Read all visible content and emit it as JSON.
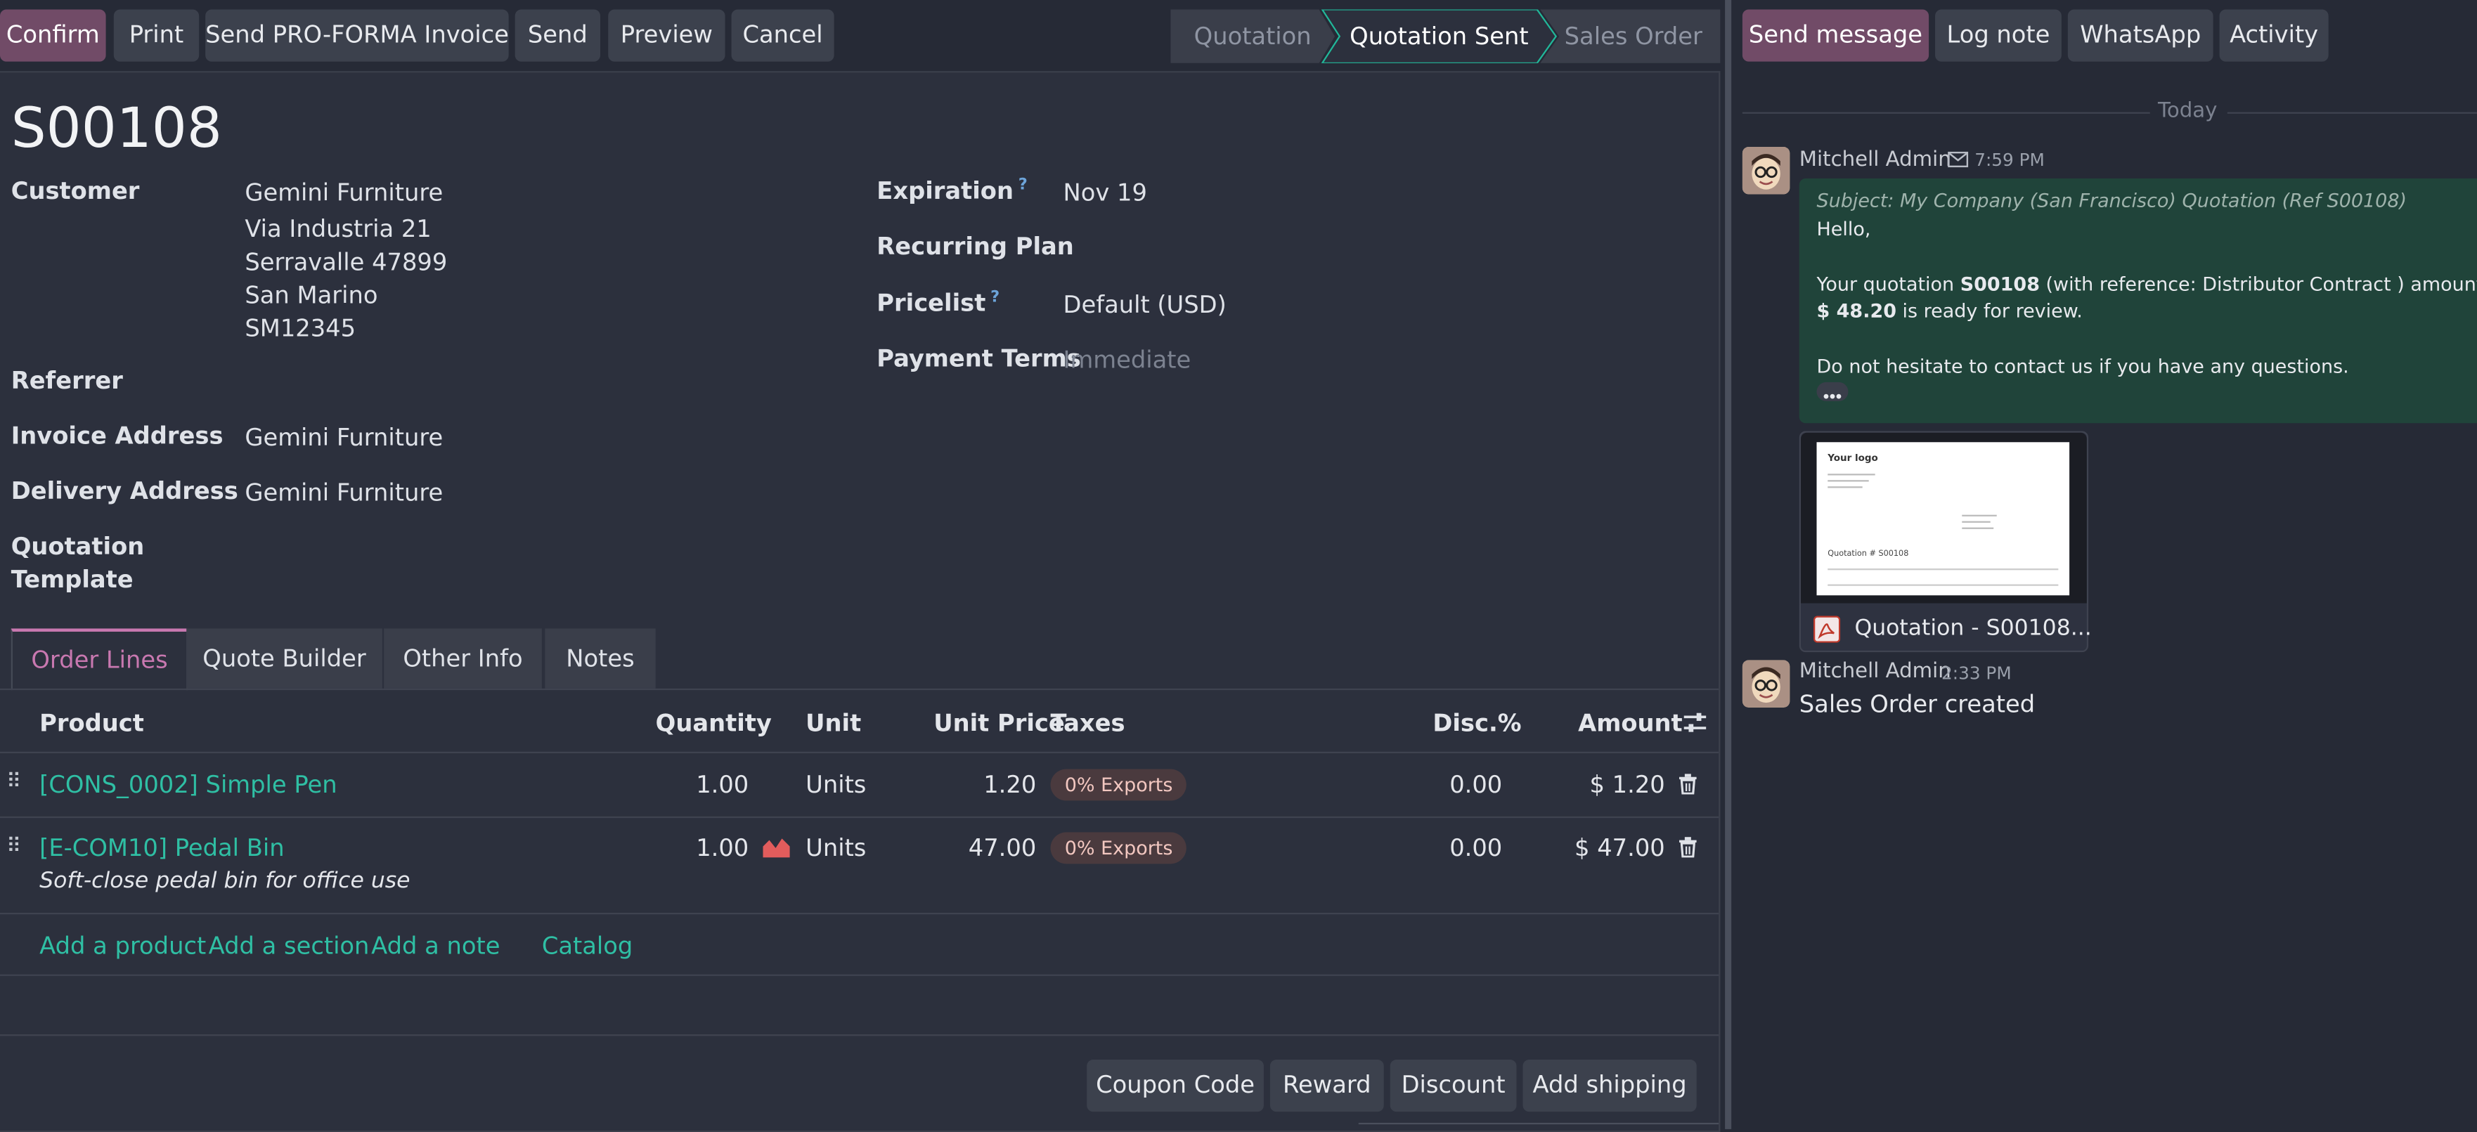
{
  "toolbar": {
    "confirm": "Confirm",
    "print": "Print",
    "send_proforma": "Send PRO-FORMA Invoice",
    "send": "Send",
    "preview": "Preview",
    "cancel": "Cancel"
  },
  "status": {
    "stages": [
      "Quotation",
      "Quotation Sent",
      "Sales Order"
    ],
    "active_stage": "Quotation Sent"
  },
  "record": {
    "name": "S00108",
    "customer_label": "Customer",
    "customer_lines": [
      "Gemini Furniture",
      "Via Industria 21",
      "Serravalle 47899",
      "San Marino",
      "SM12345"
    ],
    "referrer_label": "Referrer",
    "invoice_address_label": "Invoice Address",
    "invoice_address": "Gemini Furniture",
    "delivery_address_label": "Delivery Address",
    "delivery_address": "Gemini Furniture",
    "quotation_template_label_1": "Quotation",
    "quotation_template_label_2": "Template",
    "expiration_label": "Expiration",
    "expiration": "Nov 19",
    "recurring_plan_label": "Recurring Plan",
    "pricelist_label": "Pricelist",
    "pricelist": "Default (USD)",
    "payment_terms_label": "Payment Terms",
    "payment_terms_placeholder": "Immediate",
    "help_mark": "?"
  },
  "tabs": [
    "Order Lines",
    "Quote Builder",
    "Other Info",
    "Notes"
  ],
  "lines": {
    "headers": {
      "product": "Product",
      "quantity": "Quantity",
      "unit": "Unit",
      "unit_price": "Unit Price",
      "taxes": "Taxes",
      "disc": "Disc.%",
      "amount": "Amount"
    },
    "rows": [
      {
        "product": "[CONS_0002] Simple Pen",
        "quantity": "1.00",
        "unit": "Units",
        "unit_price": "1.20",
        "tax": "0% Exports",
        "disc": "0.00",
        "amount": "$ 1.20",
        "description": ""
      },
      {
        "product": "[E-COM10] Pedal Bin",
        "quantity": "1.00",
        "unit": "Units",
        "unit_price": "47.00",
        "tax": "0% Exports",
        "disc": "0.00",
        "amount": "$ 47.00",
        "description": "Soft-close pedal bin for office use"
      }
    ],
    "add_product": "Add a product",
    "add_section": "Add a section",
    "add_note": "Add a note",
    "catalog": "Catalog"
  },
  "footer_buttons": {
    "coupon": "Coupon Code",
    "reward": "Reward",
    "discount": "Discount",
    "shipping": "Add shipping"
  },
  "chatter": {
    "send_message": "Send message",
    "log_note": "Log note",
    "whatsapp": "WhatsApp",
    "activity": "Activity",
    "date_separator": "Today",
    "messages": [
      {
        "author": "Mitchell Admin",
        "time": "7:59 PM",
        "subject": "Subject: My Company (San Francisco) Quotation (Ref S00108)",
        "greeting": "Hello,",
        "body_pre": "Your quotation ",
        "body_ref": "S00108",
        "body_mid": " (with reference: Distributor Contract ) amounting in",
        "body_amount": "$ 48.20",
        "body_post": " is ready for review.",
        "closing": "Do not hesitate to contact us if you have any questions.",
        "attachment": "Quotation - S00108...",
        "thumb_logo": "Your logo",
        "thumb_title": "Quotation # S00108"
      },
      {
        "author": "Mitchell Admin",
        "time": "2:33 PM",
        "body": "Sales Order created"
      }
    ]
  },
  "colors": {
    "primary": "#714b67",
    "accent_link": "#2fbfa4",
    "active_tab": "#c878b0",
    "status_active_border": "#21b799"
  }
}
